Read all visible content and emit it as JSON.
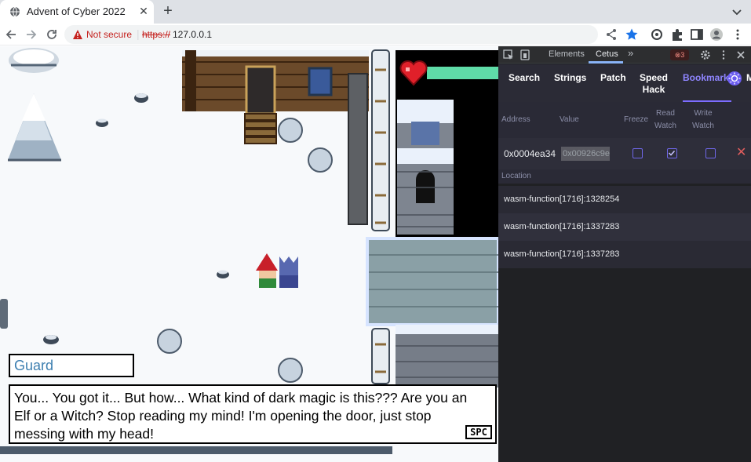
{
  "browser": {
    "tab_title": "Advent of Cyber 2022",
    "tab_close": "✕",
    "new_tab": "+",
    "not_secure_label": "Not secure",
    "url_scheme": "https://",
    "url_host": "127.0.0.1"
  },
  "devtools": {
    "tabs": {
      "elements": "Elements",
      "cetus": "Cetus",
      "more": "»"
    },
    "error_count": "3",
    "cetus": {
      "nav": {
        "search": "Search",
        "strings": "Strings",
        "patch": "Patch",
        "speed_hack": "Speed Hack",
        "bookmarks": "Bookmark",
        "overflow": "M"
      },
      "bookmarks": {
        "columns": {
          "address": "Address",
          "value": "Value",
          "freeze": "Freeze",
          "read_watch": "Read Watch",
          "write_watch": "Write Watch"
        },
        "row": {
          "address": "0x0004ea34",
          "value": "0x00926c9e",
          "freeze": false,
          "read_watch": true,
          "write_watch": false,
          "delete": "✕"
        },
        "location_header": "Location",
        "locations": [
          "wasm-function[1716]:1328254",
          "wasm-function[1716]:1337283",
          "wasm-function[1716]:1337283"
        ]
      }
    }
  },
  "game": {
    "speaker": "Guard",
    "dialog": "You... You got it... But how... What kind of dark magic is this??? Are you an Elf or a Witch? Stop reading my mind! I'm opening the door, just stop messing with my head!",
    "continue_key": "SPC",
    "health_fraction": 1.0
  },
  "colors": {
    "accent": "#7c6cff",
    "health": "#5fdca8",
    "danger": "#e05d5d",
    "speaker": "#3d7fb0"
  },
  "icons": [
    "favicon-globe-icon",
    "close-icon",
    "plus-icon",
    "chevron-down-icon",
    "back-icon",
    "forward-icon",
    "reload-icon",
    "warning-icon",
    "share-icon",
    "star-icon",
    "extension-icon",
    "puzzle-icon",
    "sidebar-icon",
    "profile-icon",
    "kebab-menu-icon",
    "inspect-icon",
    "device-icon",
    "settings-icon",
    "sun-icon",
    "heart-icon"
  ]
}
